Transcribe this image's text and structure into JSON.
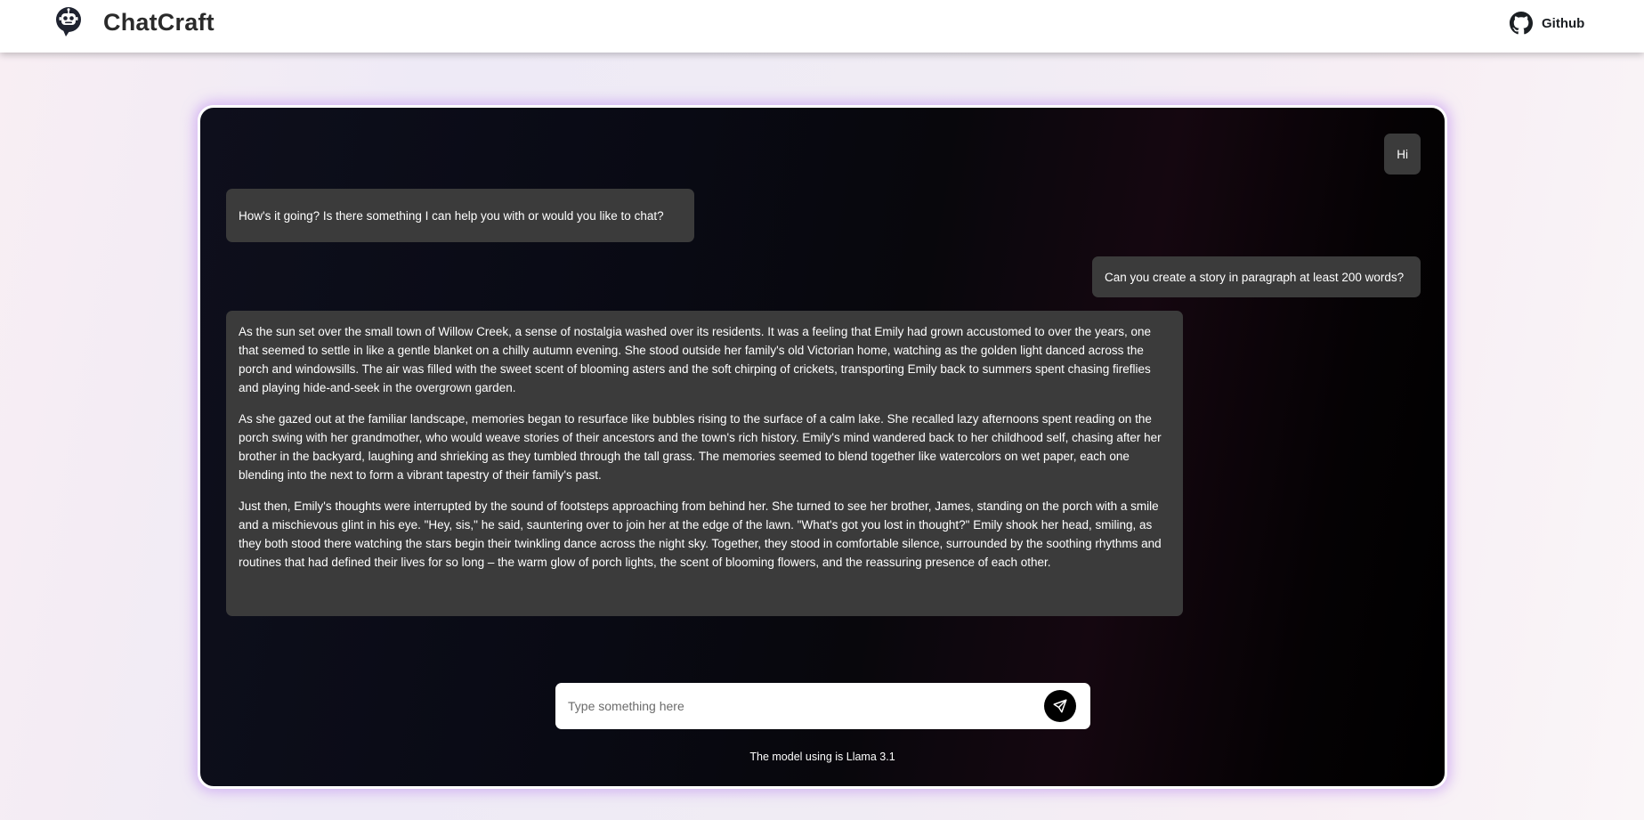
{
  "header": {
    "brand": "ChatCraft",
    "logo_icon": "robot-chat-icon",
    "github_label": "Github",
    "github_icon": "github-icon"
  },
  "chat": {
    "messages": [
      {
        "role": "user",
        "text": "Hi"
      },
      {
        "role": "assistant",
        "text": "How's it going? Is there something I can help you with or would you like to chat?"
      },
      {
        "role": "user",
        "text": "Can you create a story in paragraph at least 200 words?"
      },
      {
        "role": "assistant",
        "paragraphs": [
          "As the sun set over the small town of Willow Creek, a sense of nostalgia washed over its residents. It was a feeling that Emily had grown accustomed to over the years, one that seemed to settle in like a gentle blanket on a chilly autumn evening. She stood outside her family's old Victorian home, watching as the golden light danced across the porch and windowsills. The air was filled with the sweet scent of blooming asters and the soft chirping of crickets, transporting Emily back to summers spent chasing fireflies and playing hide-and-seek in the overgrown garden.",
          "As she gazed out at the familiar landscape, memories began to resurface like bubbles rising to the surface of a calm lake. She recalled lazy afternoons spent reading on the porch swing with her grandmother, who would weave stories of their ancestors and the town's rich history. Emily's mind wandered back to her childhood self, chasing after her brother in the backyard, laughing and shrieking as they tumbled through the tall grass. The memories seemed to blend together like watercolors on wet paper, each one blending into the next to form a vibrant tapestry of their family's past.",
          "Just then, Emily's thoughts were interrupted by the sound of footsteps approaching from behind her. She turned to see her brother, James, standing on the porch with a smile and a mischievous glint in his eye. \"Hey, sis,\" he said, sauntering over to join her at the edge of the lawn. \"What's got you lost in thought?\" Emily shook her head, smiling, as they both stood there watching the stars begin their twinkling dance across the night sky. Together, they stood in comfortable silence, surrounded by the soothing rhythms and routines that had defined their lives for so long – the warm glow of porch lights, the scent of blooming flowers, and the reassuring presence of each other."
        ]
      }
    ]
  },
  "composer": {
    "placeholder": "Type something here",
    "value": "",
    "send_icon": "send-icon"
  },
  "footer_note": "The model using is Llama 3.1",
  "colors": {
    "bubble": "#3b3b3b",
    "panel_glow": "#be8cf0",
    "send_button": "#000000"
  }
}
